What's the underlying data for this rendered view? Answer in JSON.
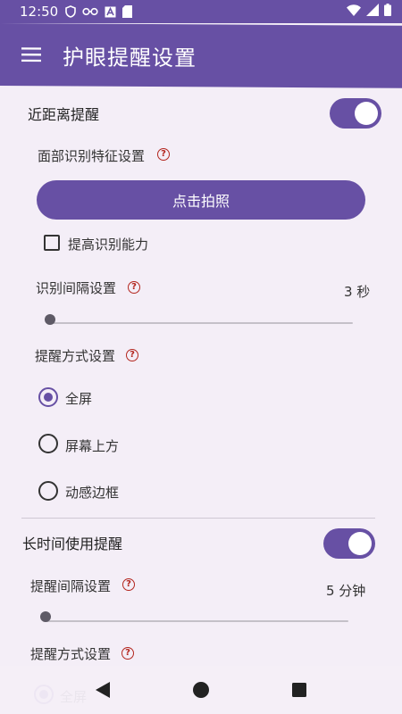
{
  "status_bar": {
    "time": "12:50",
    "left_icons": [
      "shield-icon",
      "glasses-icon",
      "a-box-icon",
      "sd-card-icon"
    ],
    "right_icons": [
      "wifi-icon",
      "signal-icon",
      "battery-icon"
    ]
  },
  "app_bar": {
    "title": "护眼提醒设置",
    "menu_icon": "menu-icon"
  },
  "near_section": {
    "label": "近距离提醒",
    "switch_on": true,
    "face_setting_label": "面部识别特征设置",
    "photo_button_label": "点击拍照",
    "improve_label": "提高识别能力",
    "improve_checked": false,
    "interval_label": "识别间隔设置",
    "interval_value": "3 秒",
    "interval_slider_fraction": 0.0,
    "mode_label": "提醒方式设置",
    "mode_options": [
      "全屏",
      "屏幕上方",
      "动感边框"
    ],
    "mode_selected": "全屏"
  },
  "long_section": {
    "label": "长时间使用提醒",
    "switch_on": true,
    "interval_label": "提醒间隔设置",
    "interval_value": "5 分钟",
    "interval_slider_fraction": 0.0,
    "mode_label": "提醒方式设置",
    "mode_first_option": "全屏"
  },
  "nav_bar": {
    "back_icon": "back-triangle-icon",
    "home_icon": "home-circle-icon",
    "recents_icon": "recents-square-icon"
  },
  "colors": {
    "accent": "#6750a4",
    "background": "#f4eef7",
    "help_icon": "#b3261e"
  }
}
